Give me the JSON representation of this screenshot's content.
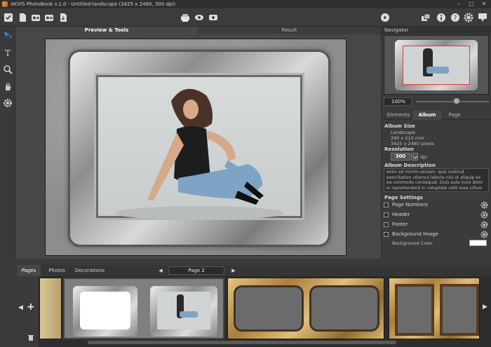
{
  "window": {
    "title": "AKVIS PhotoBook v.1.0 - Untitled-landscape (3425 x 2480, 300 dpi)",
    "controls": [
      "–",
      "□",
      "✕"
    ]
  },
  "center": {
    "tabs": [
      "Preview & Tools",
      "Result"
    ],
    "active_tab": "Preview & Tools"
  },
  "navigator": {
    "title": "Navigator",
    "zoom": "100%"
  },
  "panel": {
    "tabs": [
      "Elements",
      "Album",
      "Page"
    ],
    "active_tab": "Album",
    "album_size_label": "Album Size",
    "orientation": "Landscape",
    "size_mm": "290 x 210 mm",
    "size_px": "3425 x 2480 pixels",
    "resolution_label": "Resolution",
    "resolution_value": "300",
    "resolution_unit": "dpi",
    "description_label": "Album Description",
    "description_text": "enim ad minim veniam, quis nostrud exercitation ullamco laboris nisi ut aliquip ex ea commodo consequat. Duis aute irure dolor in reprehenderit in voluptate velit esse cillum",
    "page_settings_label": "Page Settings",
    "checkboxes": [
      "Page Numbers",
      "Header",
      "Footer",
      "Background Image"
    ],
    "bg_color_label": "Background Color",
    "bg_color": "#ffffff"
  },
  "bottom": {
    "tabs": [
      "Pages",
      "Photos",
      "Decorations"
    ],
    "active_tab": "Pages",
    "page_selector": "Page 2",
    "prev": "◀",
    "next": "▶"
  },
  "colors": {
    "accent": "#3a8ad8",
    "panel_bg": "#3b3b3b",
    "gold": "#c9a160"
  }
}
